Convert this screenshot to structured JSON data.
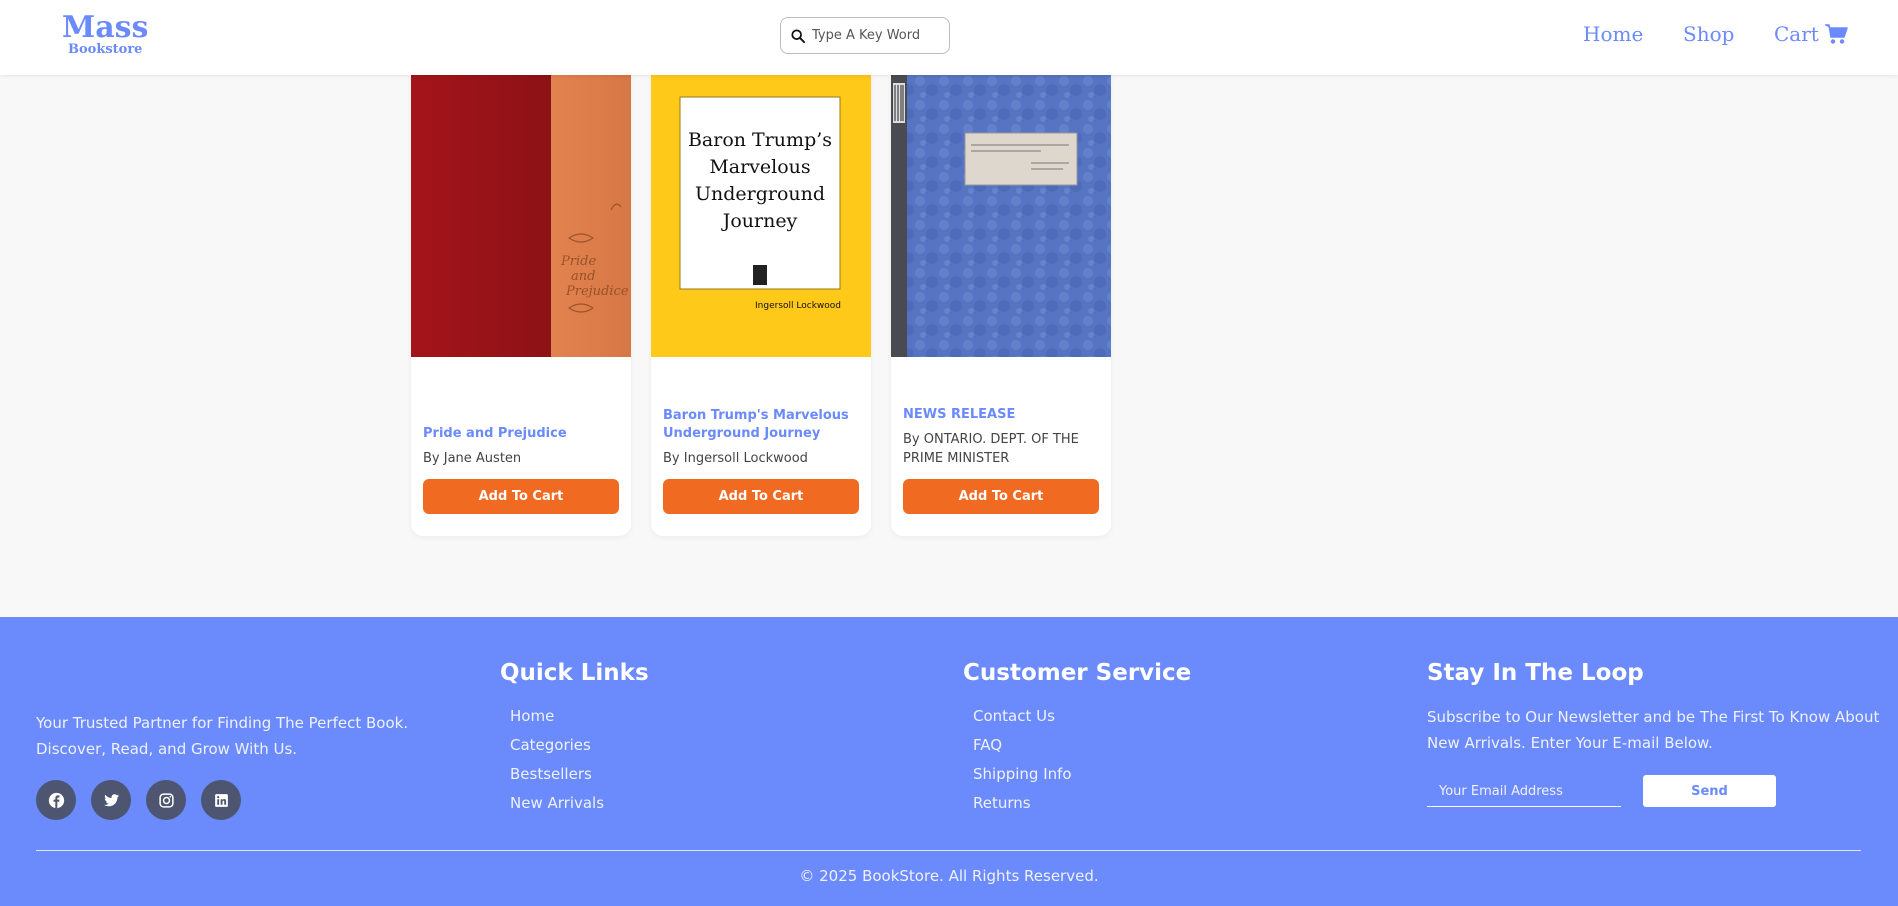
{
  "header": {
    "logo_main": "Mass",
    "logo_sub": "Bookstore",
    "search_placeholder": "Type A Key Word",
    "nav": {
      "home": "Home",
      "shop": "Shop",
      "cart": "Cart"
    }
  },
  "products": [
    {
      "title": "Pride and Prejudice",
      "author": "By Jane Austen",
      "button": "Add To Cart"
    },
    {
      "title": "Baron Trump's Marvelous Underground Journey",
      "author": "By Ingersoll Lockwood",
      "button": "Add To Cart",
      "cover_title": "Baron Trump’s Marvelous Underground Journey",
      "cover_author": "Ingersoll Lockwood"
    },
    {
      "title": "NEWS RELEASE",
      "author": "By ONTARIO. DEPT. OF THE PRIME MINISTER",
      "button": "Add To Cart"
    }
  ],
  "footer": {
    "tagline": "Your Trusted Partner for Finding The Perfect Book. Discover, Read, and Grow With Us.",
    "quick_links": {
      "title": "Quick Links",
      "items": [
        "Home",
        "Categories",
        "Bestsellers",
        "New Arrivals"
      ]
    },
    "customer_service": {
      "title": "Customer Service",
      "items": [
        "Contact Us",
        "FAQ",
        "Shipping Info",
        "Returns"
      ]
    },
    "newsletter": {
      "title": "Stay In The Loop",
      "text": "Subscribe to Our Newsletter and be The First To Know About New Arrivals. Enter Your E-mail Below.",
      "placeholder": "Your Email Address",
      "button": "Send"
    },
    "copyright": "© 2025 BookStore. All Rights Reserved."
  },
  "colors": {
    "accent": "#6b8afc",
    "button": "#f06a22",
    "social": "#4d5570"
  },
  "icons": [
    "search-icon",
    "cart-icon",
    "facebook-icon",
    "twitter-icon",
    "instagram-icon",
    "linkedin-icon"
  ]
}
